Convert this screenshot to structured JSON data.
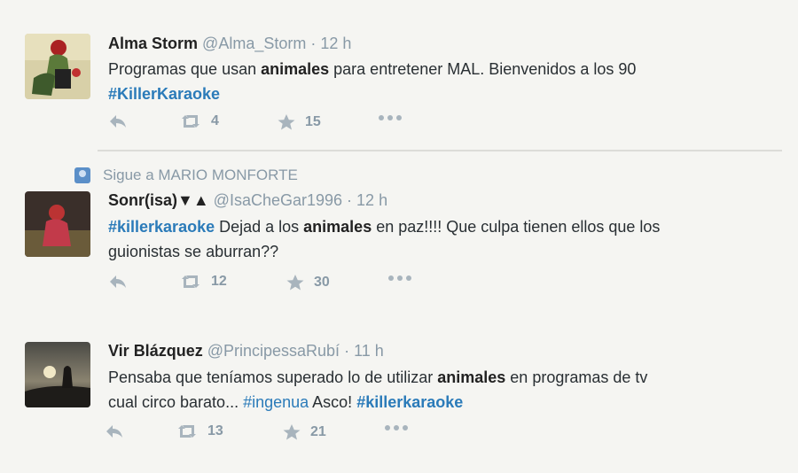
{
  "tweets": [
    {
      "name": "Alma Storm",
      "handle": "@Alma_Storm",
      "time": "· 12 h",
      "text_parts": [
        "Programas que usan ",
        "animales",
        " para entretener MAL. Bienvenidos a los 90"
      ],
      "hashtags": [
        "#KillerKaraoke"
      ],
      "retweets": "4",
      "favorites": "15"
    },
    {
      "context": "Sigue a MARIO MONFORTE",
      "name": "Sonr(isa)▼▲",
      "handle": "@IsaCheGar1996",
      "time": "· 12 h",
      "text_parts": [
        "#killerkaraoke",
        " Dejad a los ",
        "animales",
        " en paz!!!!  Que culpa tienen ellos que los",
        "guionistas se aburran??"
      ],
      "retweets": "12",
      "favorites": "30"
    },
    {
      "name": "Vir Blázquez",
      "handle": "@PrincipessaRubí",
      "time": "· 11 h",
      "text_parts": [
        "Pensaba que teníamos superado lo de utilizar ",
        "animales",
        " en programas de tv",
        "cual circo barato... ",
        "#ingenua",
        " Asco! ",
        "#killerkaraoke"
      ],
      "retweets": "13",
      "favorites": "21"
    }
  ],
  "colors": {
    "link": "#2b7bb9",
    "muted": "#8899a6",
    "background": "#f5f5f2"
  },
  "icons": [
    "reply-icon",
    "retweet-icon",
    "favorite-icon",
    "more-icon",
    "follow-icon"
  ]
}
